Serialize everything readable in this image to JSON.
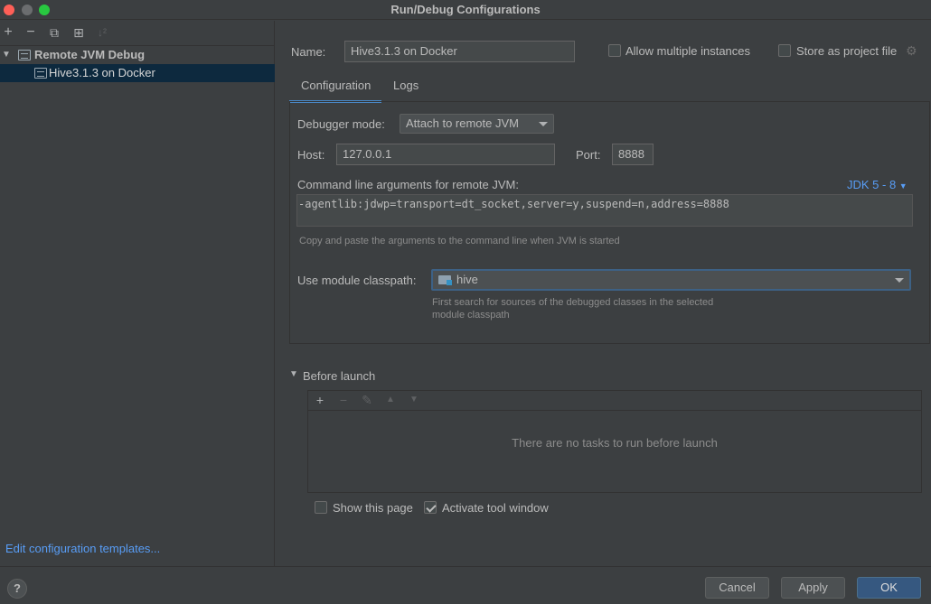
{
  "window": {
    "title": "Run/Debug Configurations"
  },
  "toolbar": {
    "add": "+",
    "remove": "−",
    "copy": "⧉",
    "folder": "⊞",
    "sort": "↓²"
  },
  "tree": {
    "group_label": "Remote JVM Debug",
    "item_label": "Hive3.1.3 on Docker",
    "expanded_icon": "chevron-down-icon"
  },
  "left": {
    "edit_templates": "Edit configuration templates..."
  },
  "form": {
    "name_label": "Name:",
    "name_value": "Hive3.1.3 on Docker",
    "allow_multiple_label": "Allow multiple instances",
    "allow_multiple_checked": false,
    "store_label": "Store as project file",
    "store_checked": false,
    "tabs": [
      {
        "label": "Configuration",
        "active": true
      },
      {
        "label": "Logs",
        "active": false
      }
    ],
    "debugger_mode_label": "Debugger mode:",
    "debugger_mode_value": "Attach to remote JVM",
    "host_label": "Host:",
    "host_value": "127.0.0.1",
    "port_label": "Port:",
    "port_value": "8888",
    "cmd_label": "Command line arguments for remote JVM:",
    "jdk_label": "JDK 5 - 8 ",
    "cmd_value": "-agentlib:jdwp=transport=dt_socket,server=y,suspend=n,address=8888",
    "cmd_hint": "Copy and paste the arguments to the command line when JVM is started",
    "module_label": "Use module classpath:",
    "module_value": "hive",
    "module_hint_1": "First search for sources of the debugged classes in the selected",
    "module_hint_2": "module classpath"
  },
  "before_launch": {
    "label": "Before launch",
    "empty_text": "There are no tasks to run before launch",
    "show_page_label": "Show this page",
    "show_page_checked": false,
    "activate_tool_label": "Activate tool window",
    "activate_tool_checked": true
  },
  "footer": {
    "help": "?",
    "cancel": "Cancel",
    "apply": "Apply",
    "ok": "OK"
  },
  "colors": {
    "background": "#3c3f41",
    "link": "#589df6",
    "selection": "#0d293e",
    "primary_button": "#365880"
  }
}
